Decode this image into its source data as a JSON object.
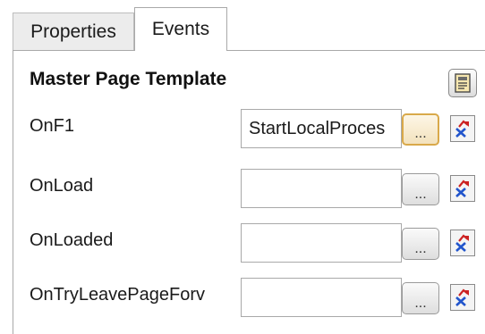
{
  "tabs": [
    {
      "label": "Properties"
    },
    {
      "label": "Events"
    }
  ],
  "section": {
    "title": "Master Page Template"
  },
  "events": [
    {
      "name": "OnF1",
      "value": "StartLocalProces"
    },
    {
      "name": "OnLoad",
      "value": ""
    },
    {
      "name": "OnLoaded",
      "value": ""
    },
    {
      "name": "OnTryLeavePageForv",
      "value": ""
    }
  ],
  "buttons": {
    "ellipsis_label": "..."
  },
  "icons": {
    "template": "page-template-icon",
    "clear": "clear-event-icon"
  },
  "colors": {
    "active_button_border": "#d9a94a",
    "clear_icon_red": "#cc2222",
    "clear_icon_blue": "#2255cc"
  }
}
